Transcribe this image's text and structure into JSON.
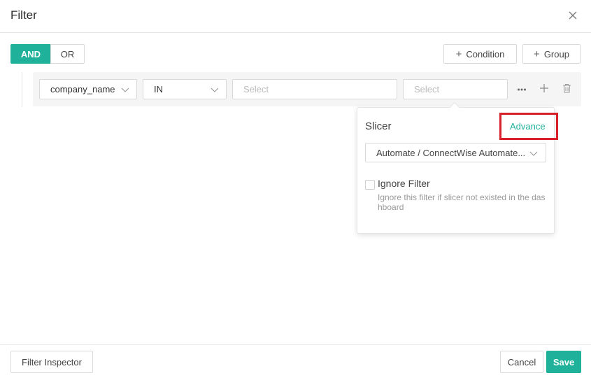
{
  "dialog": {
    "title": "Filter"
  },
  "logic": {
    "and_label": "AND",
    "or_label": "OR"
  },
  "toolbar": {
    "condition_label": "Condition",
    "group_label": "Group"
  },
  "condition_row": {
    "field_value": "company_name",
    "operator_value": "IN",
    "value_placeholder": "Select",
    "slicer_placeholder": "Select",
    "icons": [
      "more-icon",
      "plus-icon",
      "trash-icon"
    ]
  },
  "popover": {
    "slicer_label": "Slicer",
    "advance_label": "Advance",
    "slicer_value": "Automate / ConnectWise Automate...",
    "ignore_label": "Ignore Filter",
    "ignore_checked": false,
    "ignore_description": "Ignore this filter if slicer not existed in the dashboard"
  },
  "footer": {
    "inspector_label": "Filter Inspector",
    "cancel_label": "Cancel",
    "save_label": "Save"
  },
  "colors": {
    "accent": "#1fb19a",
    "highlight": "#d8202a"
  }
}
